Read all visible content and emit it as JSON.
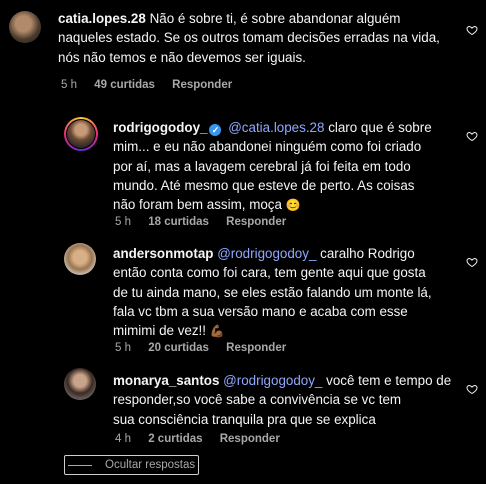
{
  "comments": [
    {
      "username": "catia.lopes.28",
      "mention": "",
      "text_lines": [
        "Não é sobre ti, é sobre abandonar alguém",
        "naqueles estado. Se os outros tomam decisões erradas na vida,",
        "nós não temos e não devemos ser iguais."
      ],
      "time": "5 h",
      "likes": "49 curtidas",
      "reply_label": "Responder",
      "like_icon": "heart-outline-icon"
    },
    {
      "username": "rodrigogodoy_",
      "verified": true,
      "mention": "@catia.lopes.28",
      "text_lines": [
        "claro que é sobre",
        "mim... e eu não abandonei ninguém como foi criado",
        "por aí, mas a lavagem cerebral já foi feita em todo",
        "mundo. Até mesmo que esteve de perto. As coisas",
        "não foram bem assim, moça"
      ],
      "emoji": "😊",
      "time": "5 h",
      "likes": "18 curtidas",
      "reply_label": "Responder",
      "like_icon": "heart-outline-icon"
    },
    {
      "username": "andersonmotap",
      "mention": "@rodrigogodoy_",
      "text_lines": [
        "caralho Rodrigo",
        "então conta como foi cara, tem gente aqui que gosta",
        "de tu ainda mano, se eles estão falando um monte lá,",
        "fala vc tbm a sua versão mano e acaba com esse",
        "mimimi de vez!!"
      ],
      "emoji": "💪🏾",
      "time": "5 h",
      "likes": "20 curtidas",
      "reply_label": "Responder",
      "like_icon": "heart-outline-icon"
    },
    {
      "username": "monarya_santos",
      "mention": "@rodrigogodoy_",
      "text_lines": [
        "você tem e tempo de",
        "responder,so você sabe a convivência se vc tem",
        "sua consciência tranquila pra que se explica"
      ],
      "time": "4 h",
      "likes": "2 curtidas",
      "reply_label": "Responder",
      "like_icon": "heart-outline-icon"
    }
  ],
  "hide_replies_label": "Ocultar respostas",
  "colors": {
    "background": "#000000",
    "text": "#f5f5f5",
    "muted": "#a8a8a8",
    "mention": "#8fa8ff",
    "verified": "#3797f0"
  }
}
